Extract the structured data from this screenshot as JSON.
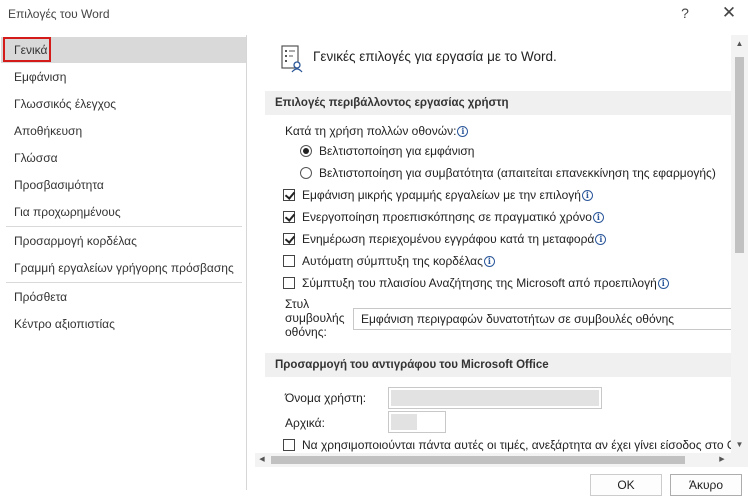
{
  "window": {
    "title": "Επιλογές του Word",
    "help": "?",
    "close": "✕"
  },
  "sidebar": {
    "items": [
      {
        "label": "Γενικά"
      },
      {
        "label": "Εμφάνιση"
      },
      {
        "label": "Γλωσσικός έλεγχος"
      },
      {
        "label": "Αποθήκευση"
      },
      {
        "label": "Γλώσσα"
      },
      {
        "label": "Προσβασιμότητα"
      },
      {
        "label": "Για προχωρημένους"
      },
      {
        "label": "Προσαρμογή κορδέλας"
      },
      {
        "label": "Γραμμή εργαλείων γρήγορης πρόσβασης"
      },
      {
        "label": "Πρόσθετα"
      },
      {
        "label": "Κέντρο αξιοπιστίας"
      }
    ],
    "selected": "Γενικά"
  },
  "content": {
    "header": "Γενικές επιλογές για εργασία με το Word.",
    "section1": {
      "title": "Επιλογές περιβάλλοντος εργασίας χρήστη",
      "multi_screen_label": "Κατά τη χρήση πολλών οθονών:",
      "radio_appearance": "Βελτιστοποίηση για εμφάνιση",
      "radio_compat": "Βελτιστοποίηση για συμβατότητα (απαιτείται επανεκκίνηση της εφαρμογής)",
      "cb_mini_toolbar": "Εμφάνιση μικρής γραμμής εργαλείων με την επιλογή",
      "cb_live_preview": "Ενεργοποίηση προεπισκόπησης σε πραγματικό χρόνο",
      "cb_update_drag": "Ενημέρωση περιεχομένου εγγράφου κατά τη μεταφορά",
      "cb_collapse_ribbon": "Αυτόματη σύμπτυξη της κορδέλας",
      "cb_collapse_search": "Σύμπτυξη του πλαισίου Αναζήτησης της Microsoft από προεπιλογή",
      "screentip_label": "Στυλ συμβουλής οθόνης:",
      "screentip_value": "Εμφάνιση περιγραφών δυνατοτήτων σε συμβουλές οθόνης",
      "checked": {
        "mini_toolbar": true,
        "live_preview": true,
        "update_drag": true,
        "collapse_ribbon": false,
        "collapse_search": false
      },
      "radio_selected": "appearance"
    },
    "section2": {
      "title": "Προσαρμογή του αντιγράφου του Microsoft Office",
      "username_label": "Όνομα χρήστη:",
      "initials_label": "Αρχικά:",
      "always_use": "Να χρησιμοποιούνται πάντα αυτές οι τιμές, ανεξάρτητα αν έχει γίνει είσοδος στο Office."
    },
    "info_glyph": "i"
  },
  "buttons": {
    "ok": "OK",
    "cancel": "Άκυρο"
  },
  "scroll": {
    "up": "▲",
    "down": "▼",
    "left": "◀",
    "right": "▶"
  }
}
